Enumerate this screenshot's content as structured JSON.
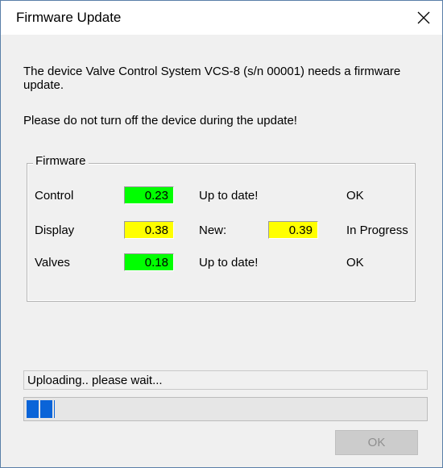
{
  "window": {
    "title": "Firmware Update",
    "close_icon": "close-icon"
  },
  "message": {
    "line1": "The device Valve Control System VCS-8 (s/n 00001) needs a firmware update.",
    "line2": "Please do not turn off the device during the update!"
  },
  "firmware": {
    "group_label": "Firmware",
    "rows": [
      {
        "name": "Control",
        "version": "0.23",
        "version_color": "#00ff00",
        "status": "Up to date!",
        "result": "OK"
      },
      {
        "name": "Display",
        "version": "0.38",
        "version_color": "#ffff00",
        "status": "New:",
        "new_version": "0.39",
        "new_version_color": "#ffff00",
        "result": "In Progress"
      },
      {
        "name": "Valves",
        "version": "0.18",
        "version_color": "#00ff00",
        "status": "Up to date!",
        "result": "OK"
      }
    ]
  },
  "status_text": "Uploading.. please wait...",
  "progress_fraction": 0.07,
  "progress_color": "#0a64d8",
  "buttons": {
    "ok_label": "OK",
    "ok_enabled": false
  }
}
